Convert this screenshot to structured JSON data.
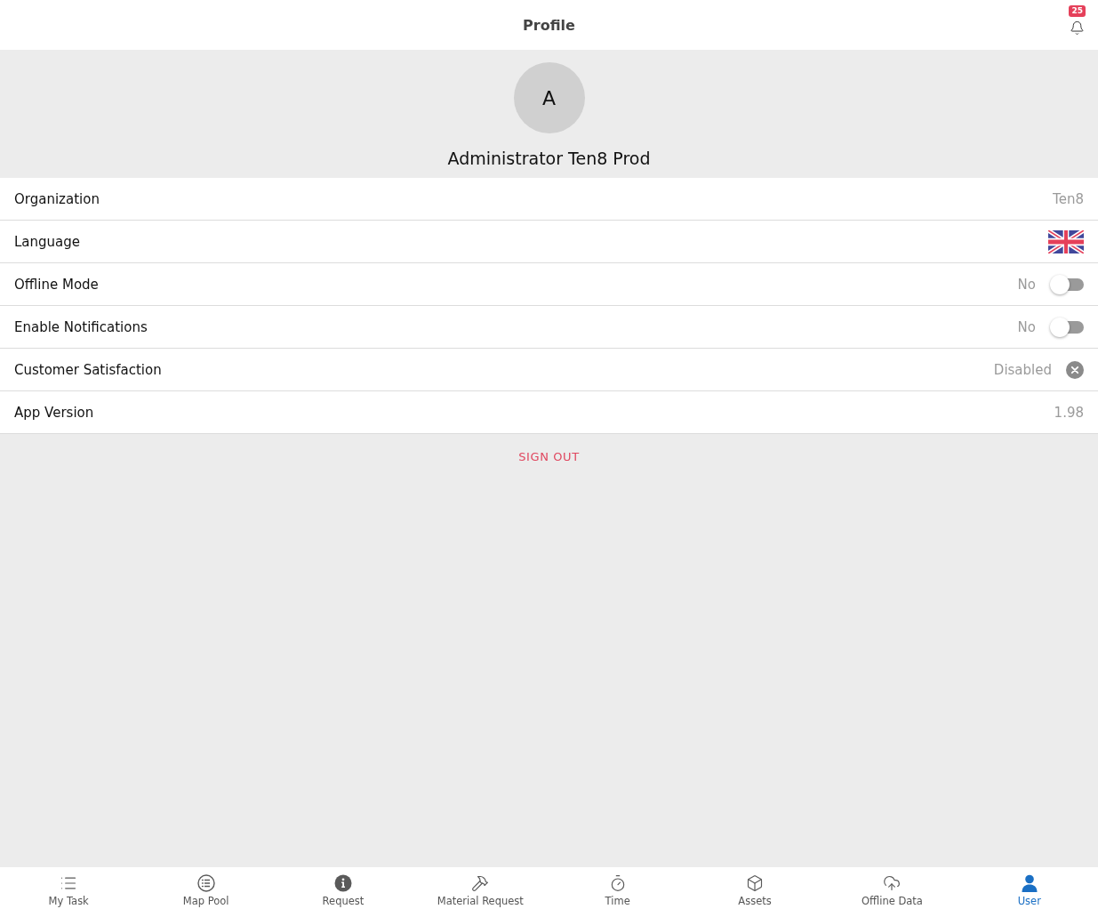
{
  "header": {
    "title": "Profile",
    "notification_count": "25"
  },
  "profile": {
    "avatar_initial": "A",
    "name": "Administrator Ten8 Prod"
  },
  "settings": [
    {
      "kind": "text",
      "label": "Organization",
      "value": "Ten8"
    },
    {
      "kind": "flag",
      "label": "Language"
    },
    {
      "kind": "toggle",
      "label": "Offline Mode",
      "value": "No",
      "on": false
    },
    {
      "kind": "toggle",
      "label": "Enable Notifications",
      "value": "No",
      "on": false
    },
    {
      "kind": "status",
      "label": "Customer Satisfaction",
      "value": "Disabled"
    },
    {
      "kind": "text",
      "label": "App Version",
      "value": "1.98"
    }
  ],
  "sign_out": "SIGN OUT",
  "tabs": [
    {
      "label": "My Task",
      "selected": false
    },
    {
      "label": "Map Pool",
      "selected": false
    },
    {
      "label": "Request",
      "selected": false
    },
    {
      "label": "Material Request",
      "selected": false
    },
    {
      "label": "Time",
      "selected": false
    },
    {
      "label": "Assets",
      "selected": false
    },
    {
      "label": "Offline Data",
      "selected": false
    },
    {
      "label": "User",
      "selected": true
    }
  ]
}
